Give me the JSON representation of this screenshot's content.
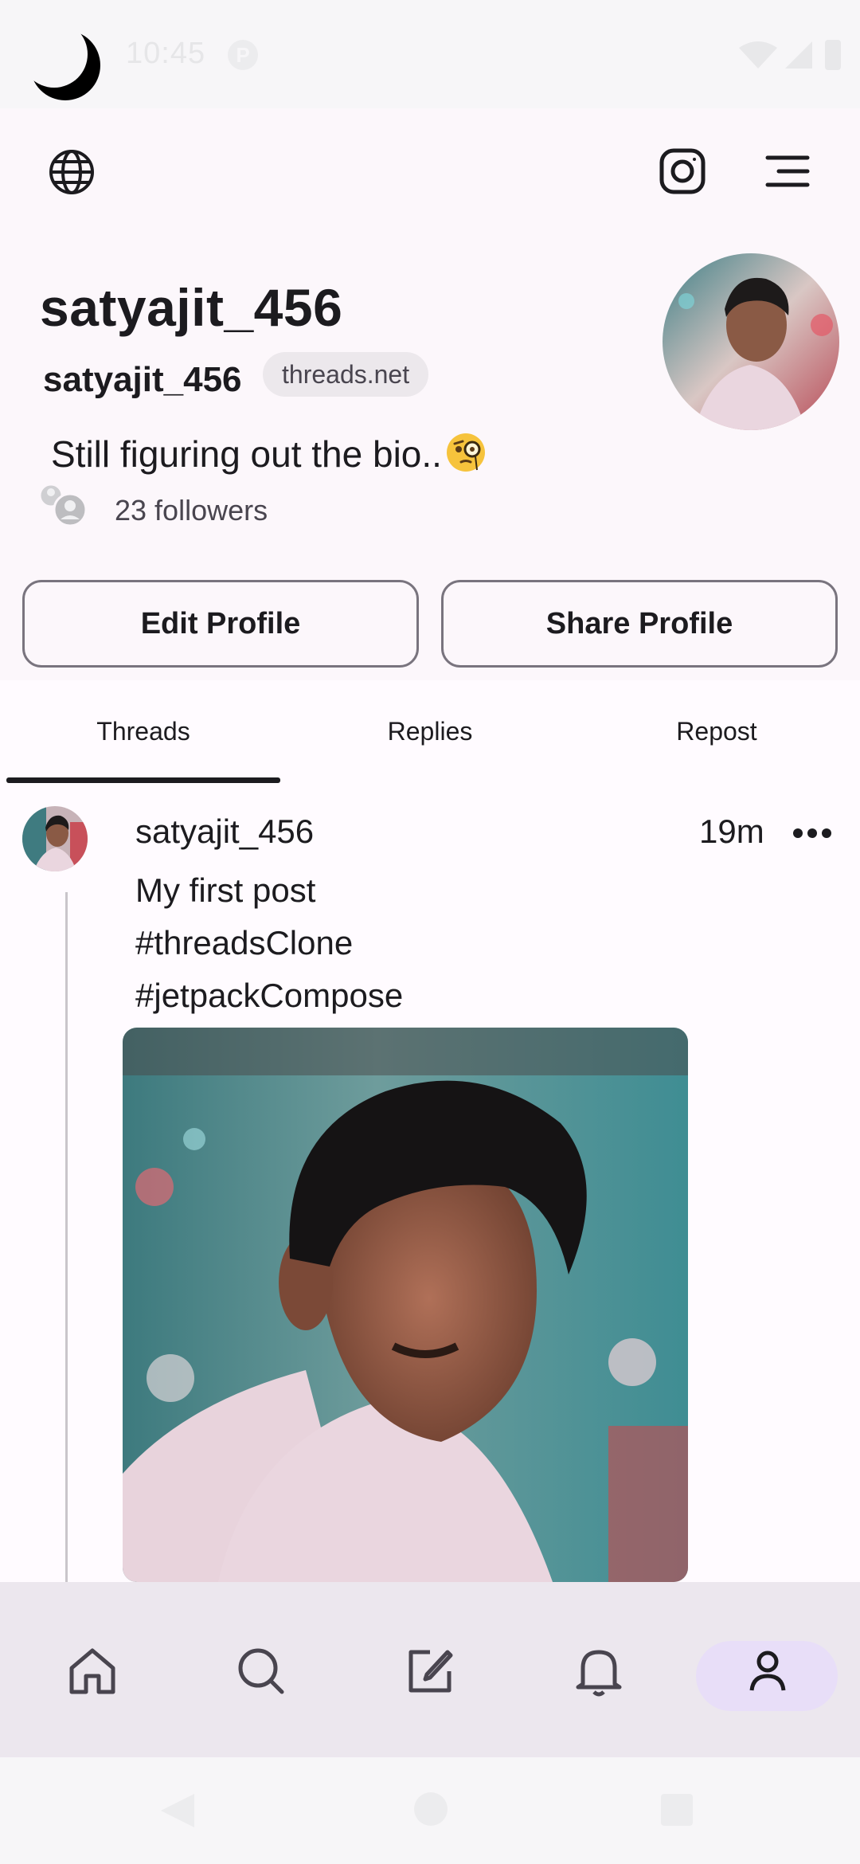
{
  "status_bar": {
    "time": "10:45",
    "notification_letter": "P"
  },
  "header": {
    "left_icon": "globe-icon",
    "right_icons": [
      "instagram-icon",
      "menu-icon"
    ]
  },
  "profile": {
    "display_name": "satyajit_456",
    "username": "satyajit_456",
    "domain_chip": "threads.net",
    "bio": "Still figuring out the bio..",
    "bio_emoji": "monocle-face-emoji",
    "followers": "23 followers",
    "edit_button": "Edit Profile",
    "share_button": "Share Profile"
  },
  "tabs": [
    {
      "label": "Threads",
      "active": true
    },
    {
      "label": "Replies",
      "active": false
    },
    {
      "label": "Repost",
      "active": false
    }
  ],
  "post": {
    "username": "satyajit_456",
    "time": "19m",
    "lines": [
      "My first post",
      "#threadsClone",
      "#jetpackCompose"
    ]
  },
  "bottom_nav": {
    "items": [
      "home-icon",
      "search-icon",
      "compose-icon",
      "notifications-icon",
      "profile-icon"
    ],
    "active": "profile-icon"
  },
  "colors": {
    "accent_pill": "#e8def8",
    "profile_background": "#fcf7fb",
    "nav_background": "#ece7ee"
  }
}
